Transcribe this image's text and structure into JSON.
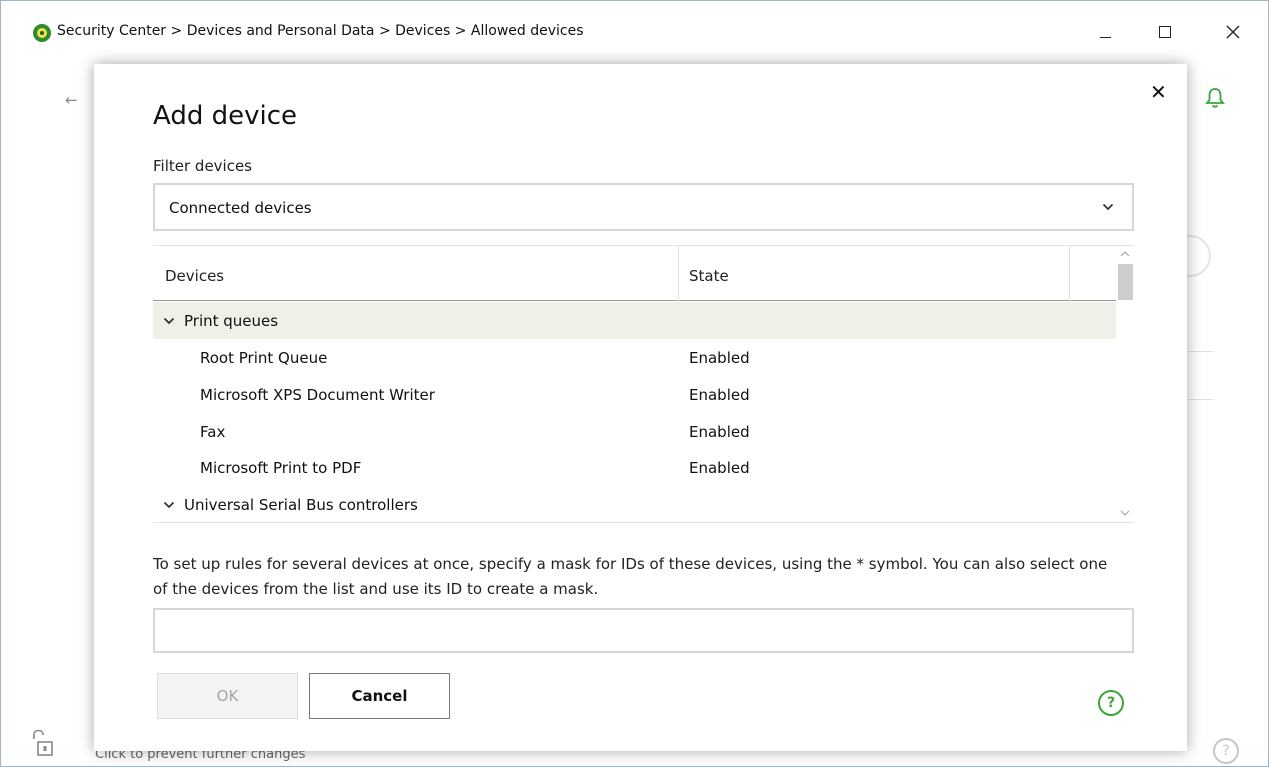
{
  "window": {
    "title": "Security Center > Devices and Personal Data > Devices > Allowed devices",
    "lock_label": "Click to prevent further changes",
    "help_glyph": "?"
  },
  "dialog": {
    "title": "Add device",
    "close_glyph": "✕",
    "filter": {
      "label": "Filter devices",
      "value": "Connected devices"
    },
    "list": {
      "columns": [
        "Devices",
        "State"
      ],
      "rows": [
        {
          "type": "group",
          "name": "Print queues"
        },
        {
          "type": "item",
          "name": "Root Print Queue",
          "state": "Enabled"
        },
        {
          "type": "item",
          "name": "Microsoft XPS Document Writer",
          "state": "Enabled"
        },
        {
          "type": "item",
          "name": "Fax",
          "state": "Enabled"
        },
        {
          "type": "item",
          "name": "Microsoft Print to PDF",
          "state": "Enabled"
        },
        {
          "type": "group",
          "name": "Universal Serial Bus controllers"
        }
      ]
    },
    "hint": "To set up rules for several devices at once, specify a mask for IDs of these devices, using the * symbol. You can also select one of the devices from the list and use its ID to create a mask.",
    "mask_value": "",
    "ok_label": "OK",
    "cancel_label": "Cancel",
    "help_glyph": "?"
  },
  "colors": {
    "accent_green": "#3aa53a",
    "group_row_bg": "#f0efe8",
    "disabled_text": "#a5a5a5"
  }
}
